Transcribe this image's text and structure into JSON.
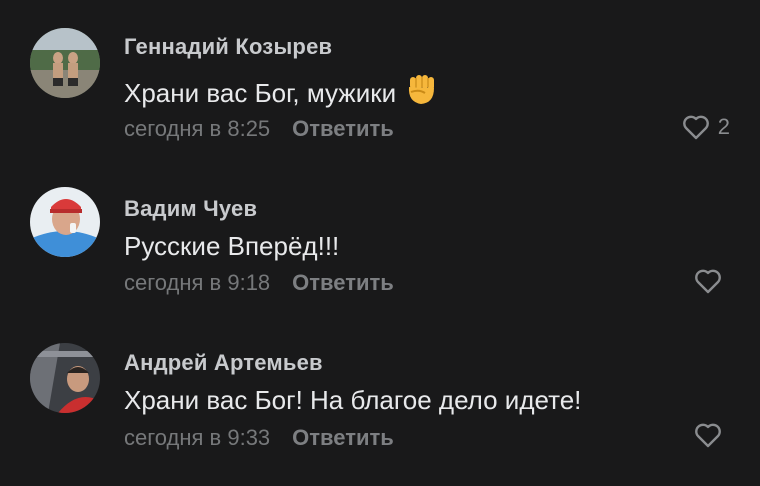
{
  "comments": [
    {
      "author": "Геннадий Козырев",
      "text": "Храни вас Бог, мужики",
      "emoji": "raised-fist-emoji",
      "time": "сегодня в 8:25",
      "reply": "Ответить",
      "likes": "2"
    },
    {
      "author": "Вадим Чуев",
      "text": "Русские Вперёд!!!",
      "time": "сегодня в 9:18",
      "reply": "Ответить",
      "likes": ""
    },
    {
      "author": "Андрей Артемьев",
      "text": "Храни вас Бог! На благое дело идете!",
      "time": "сегодня в 9:33",
      "reply": "Ответить",
      "likes": ""
    }
  ],
  "colors": {
    "background": "#19191a",
    "author": "#c8cacd",
    "text": "#e8e9eb",
    "meta": "#76787a"
  }
}
